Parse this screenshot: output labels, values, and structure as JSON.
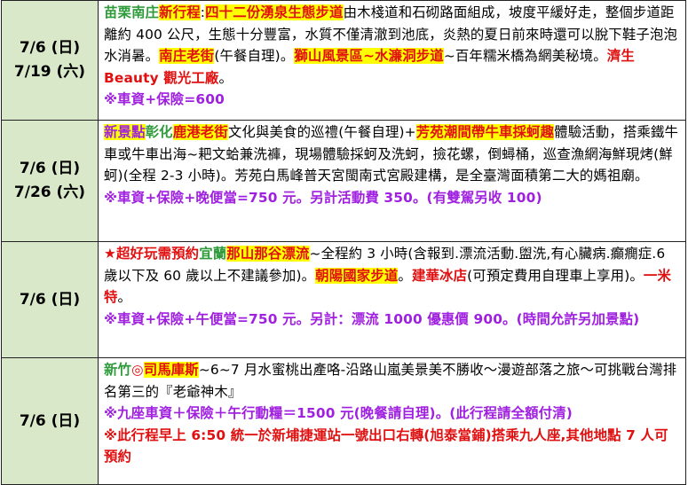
{
  "rows": [
    {
      "date1": "7/6 (日)",
      "date2": "7/19 (六)",
      "t": {
        "a": "苗栗南庄",
        "b": "新行程",
        "c": ":",
        "d": "四十二份湧泉生態步道",
        "e": "由木棧道和石砌路面組成，坡度平緩好走，整個步道距離約 400 公尺，生態十分豐富，水質不僅清澈到池底，炎熱的夏日前來時還可以脫下鞋子泡泡水消暑。",
        "f": "南庄老街",
        "g": "(午餐自理)。",
        "h": "獅山風景區~水濂洞步道",
        "i": "~百年糯米橋為網美秘境。",
        "j": "濟生 Beauty 觀光工廠",
        "k": "。",
        "l": "※車資+保險=600"
      }
    },
    {
      "date1": "7/6 (日)",
      "date2": "7/26 (六)",
      "t": {
        "a": "新景點",
        "b": "彰化",
        "c": "鹿港老街",
        "d": "文化與美食的巡禮(午餐自理)+",
        "e": "芳苑潮間帶牛車採蚵趣",
        "f": "體驗活動，搭乘鐵牛車或牛車出海~耙文蛤兼洗褲，現場體驗採蚵及洗蚵，撿花螺，倒蟳桶，巡查漁網海鮮現烤(鮮蚵)(全程 2-3 小時)。芳苑白馬峰普天宮閩南式宮殿建構，是全臺灣面積第二大的媽祖廟。",
        "g": "※車資+保險+晚便當=750 元。另計活動費 350。(有雙駕另收 100)"
      }
    },
    {
      "date1": "7/6 (日)",
      "t": {
        "a": "★超好玩需預約",
        "b": "宜蘭",
        "c": "那山那谷漂流",
        "d": "~全程約 3 小時(含報到.漂流活動.盥洗,有心臟病.癲癇症.6 歲以下及 60 歲以上不建議參加)。",
        "e": "朝陽國家步道",
        "f": "。",
        "g": "建華冰店",
        "h": "(可預定費用自理車上享用)。",
        "i": "一米特",
        "j": "。",
        "k": "※車資+保險+午便當=750 元。另計：漂流 1000 優惠價 900。(時間允許另加景點)"
      }
    },
    {
      "date1": "7/6 (日)",
      "t": {
        "a": "新竹",
        "b": "◎",
        "c": "司馬庫斯",
        "d": "~6~7 月水蜜桃出產咯-沿路山嵐美景美不勝收～漫遊部落之旅～可挑戰台灣排名第三的『老爺神木』",
        "e": "※九座車資＋保險＋午行動糧＝1500 元(晚餐請自理)。(此行程請全額付清)",
        "f": "※此行程早上 6:50 統一於新埔捷運站一號出口右轉(旭泰當鋪)搭乘九人座,其他地點 7 人可預約"
      }
    }
  ],
  "colors": {
    "date_bg": "#d9e8c9",
    "green": "#2e9b3a",
    "red": "#e01010",
    "purple": "#a020e0",
    "highlight": "#ffff00"
  }
}
